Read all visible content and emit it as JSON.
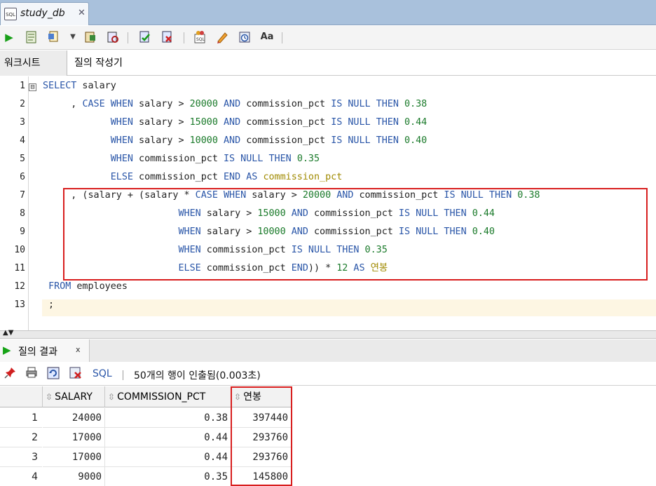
{
  "document_tab": {
    "icon_label": "SQL",
    "title": "study_db",
    "close": "✕"
  },
  "toolbar": {
    "icons": [
      "run-statement-icon",
      "run-script-icon",
      "explain-plan-icon",
      "dropdown-arrow-icon",
      "autotrace-icon",
      "sql-tuning-icon",
      "commit-icon",
      "rollback-icon",
      "unshared-worksheet-icon",
      "clear-icon",
      "history-icon",
      "format-case-icon"
    ]
  },
  "subtabs": {
    "worksheet": "워크시트",
    "query_builder": "질의 작성기"
  },
  "editor": {
    "line_numbers": [
      "1",
      "2",
      "3",
      "4",
      "5",
      "6",
      "7",
      "8",
      "9",
      "10",
      "11",
      "12",
      "13"
    ],
    "fold_marker": "⊟",
    "lines": [
      [
        {
          "t": "kw",
          "v": "SELECT"
        },
        {
          "t": "tx",
          "v": " salary"
        }
      ],
      [
        {
          "t": "tx",
          "v": "     , "
        },
        {
          "t": "kw",
          "v": "CASE WHEN"
        },
        {
          "t": "tx",
          "v": " salary > "
        },
        {
          "t": "num",
          "v": "20000"
        },
        {
          "t": "tx",
          "v": " "
        },
        {
          "t": "kw",
          "v": "AND"
        },
        {
          "t": "tx",
          "v": " commission_pct "
        },
        {
          "t": "kw",
          "v": "IS NULL THEN"
        },
        {
          "t": "tx",
          "v": " "
        },
        {
          "t": "num",
          "v": "0.38"
        }
      ],
      [
        {
          "t": "tx",
          "v": "            "
        },
        {
          "t": "kw",
          "v": "WHEN"
        },
        {
          "t": "tx",
          "v": " salary > "
        },
        {
          "t": "num",
          "v": "15000"
        },
        {
          "t": "tx",
          "v": " "
        },
        {
          "t": "kw",
          "v": "AND"
        },
        {
          "t": "tx",
          "v": " commission_pct "
        },
        {
          "t": "kw",
          "v": "IS NULL THEN"
        },
        {
          "t": "tx",
          "v": " "
        },
        {
          "t": "num",
          "v": "0.44"
        }
      ],
      [
        {
          "t": "tx",
          "v": "            "
        },
        {
          "t": "kw",
          "v": "WHEN"
        },
        {
          "t": "tx",
          "v": " salary > "
        },
        {
          "t": "num",
          "v": "10000"
        },
        {
          "t": "tx",
          "v": " "
        },
        {
          "t": "kw",
          "v": "AND"
        },
        {
          "t": "tx",
          "v": " commission_pct "
        },
        {
          "t": "kw",
          "v": "IS NULL THEN"
        },
        {
          "t": "tx",
          "v": " "
        },
        {
          "t": "num",
          "v": "0.40"
        }
      ],
      [
        {
          "t": "tx",
          "v": "            "
        },
        {
          "t": "kw",
          "v": "WHEN"
        },
        {
          "t": "tx",
          "v": " commission_pct "
        },
        {
          "t": "kw",
          "v": "IS NULL THEN"
        },
        {
          "t": "tx",
          "v": " "
        },
        {
          "t": "num",
          "v": "0.35"
        }
      ],
      [
        {
          "t": "tx",
          "v": "            "
        },
        {
          "t": "kw",
          "v": "ELSE"
        },
        {
          "t": "tx",
          "v": " commission_pct "
        },
        {
          "t": "kw",
          "v": "END AS"
        },
        {
          "t": "tx",
          "v": " "
        },
        {
          "t": "alias",
          "v": "commission_pct"
        }
      ],
      [
        {
          "t": "tx",
          "v": "     , (salary + (salary * "
        },
        {
          "t": "kw",
          "v": "CASE WHEN"
        },
        {
          "t": "tx",
          "v": " salary > "
        },
        {
          "t": "num",
          "v": "20000"
        },
        {
          "t": "tx",
          "v": " "
        },
        {
          "t": "kw",
          "v": "AND"
        },
        {
          "t": "tx",
          "v": " commission_pct "
        },
        {
          "t": "kw",
          "v": "IS NULL THEN"
        },
        {
          "t": "tx",
          "v": " "
        },
        {
          "t": "num",
          "v": "0.38"
        }
      ],
      [
        {
          "t": "tx",
          "v": "                        "
        },
        {
          "t": "kw",
          "v": "WHEN"
        },
        {
          "t": "tx",
          "v": " salary > "
        },
        {
          "t": "num",
          "v": "15000"
        },
        {
          "t": "tx",
          "v": " "
        },
        {
          "t": "kw",
          "v": "AND"
        },
        {
          "t": "tx",
          "v": " commission_pct "
        },
        {
          "t": "kw",
          "v": "IS NULL THEN"
        },
        {
          "t": "tx",
          "v": " "
        },
        {
          "t": "num",
          "v": "0.44"
        }
      ],
      [
        {
          "t": "tx",
          "v": "                        "
        },
        {
          "t": "kw",
          "v": "WHEN"
        },
        {
          "t": "tx",
          "v": " salary > "
        },
        {
          "t": "num",
          "v": "10000"
        },
        {
          "t": "tx",
          "v": " "
        },
        {
          "t": "kw",
          "v": "AND"
        },
        {
          "t": "tx",
          "v": " commission_pct "
        },
        {
          "t": "kw",
          "v": "IS NULL THEN"
        },
        {
          "t": "tx",
          "v": " "
        },
        {
          "t": "num",
          "v": "0.40"
        }
      ],
      [
        {
          "t": "tx",
          "v": "                        "
        },
        {
          "t": "kw",
          "v": "WHEN"
        },
        {
          "t": "tx",
          "v": " commission_pct "
        },
        {
          "t": "kw",
          "v": "IS NULL THEN"
        },
        {
          "t": "tx",
          "v": " "
        },
        {
          "t": "num",
          "v": "0.35"
        }
      ],
      [
        {
          "t": "tx",
          "v": "                        "
        },
        {
          "t": "kw",
          "v": "ELSE"
        },
        {
          "t": "tx",
          "v": " commission_pct "
        },
        {
          "t": "kw",
          "v": "END"
        },
        {
          "t": "tx",
          "v": ")) * "
        },
        {
          "t": "num",
          "v": "12"
        },
        {
          "t": "tx",
          "v": " "
        },
        {
          "t": "kw",
          "v": "AS"
        },
        {
          "t": "tx",
          "v": " "
        },
        {
          "t": "alias",
          "v": "연봉"
        }
      ],
      [
        {
          "t": "tx",
          "v": " "
        },
        {
          "t": "kw",
          "v": "FROM"
        },
        {
          "t": "tx",
          "v": " employees"
        }
      ],
      [
        {
          "t": "tx",
          "v": " ;"
        }
      ]
    ]
  },
  "results": {
    "tab_label": "질의 결과",
    "tab_close": "x",
    "toolbar_icons": [
      "pin-icon",
      "print-icon",
      "refresh-icon",
      "sql-delete-icon"
    ],
    "sql_link": "SQL",
    "status": "50개의 행이 인출됨(0.003초)",
    "columns": [
      "SALARY",
      "COMMISSION_PCT",
      "연봉"
    ],
    "rows": [
      {
        "n": "1",
        "c": [
          "24000",
          "0.38",
          "397440"
        ]
      },
      {
        "n": "2",
        "c": [
          "17000",
          "0.44",
          "293760"
        ]
      },
      {
        "n": "3",
        "c": [
          "17000",
          "0.44",
          "293760"
        ]
      },
      {
        "n": "4",
        "c": [
          "9000",
          "0.35",
          "145800"
        ]
      }
    ]
  },
  "colors": {
    "keyword": "#2a56a8",
    "number": "#1a7a2a",
    "alias": "#a08a00",
    "highlight": "#d81e1e"
  }
}
